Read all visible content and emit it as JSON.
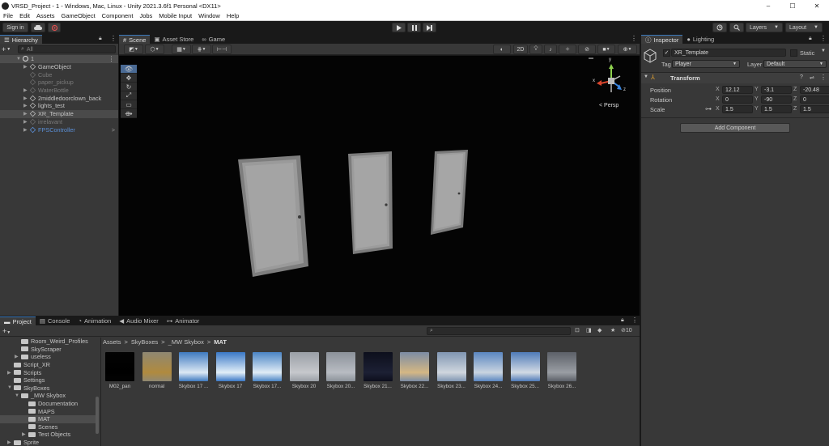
{
  "window": {
    "title": "VRSD_Project - 1 - Windows, Mac, Linux - Unity 2021.3.6f1 Personal <DX11>",
    "minimize": "–",
    "maximize": "☐",
    "close": "✕"
  },
  "menu": [
    "File",
    "Edit",
    "Assets",
    "GameObject",
    "Component",
    "Jobs",
    "Mobile Input",
    "Window",
    "Help"
  ],
  "toolbar": {
    "sign_in": "Sign in",
    "layers": "Layers",
    "layout": "Layout"
  },
  "hierarchy": {
    "tab": "Hierarchy",
    "search_placeholder": "All",
    "scene_name": "1",
    "items": [
      {
        "label": "GameObject",
        "state": "normal",
        "arrow": "▶"
      },
      {
        "label": "Cube",
        "state": "disabled",
        "arrow": ""
      },
      {
        "label": "paper_pickup",
        "state": "disabled",
        "arrow": ""
      },
      {
        "label": "WaterBottle",
        "state": "disabled",
        "arrow": "▶"
      },
      {
        "label": "2middledoorclown_back",
        "state": "normal",
        "arrow": "▶"
      },
      {
        "label": "lights_test",
        "state": "normal",
        "arrow": "▶"
      },
      {
        "label": "XR_Template",
        "state": "selected",
        "arrow": "▶"
      },
      {
        "label": "irrelavant",
        "state": "disabled",
        "arrow": "▶"
      },
      {
        "label": "FPSController",
        "state": "prefab",
        "arrow": "▶"
      }
    ]
  },
  "scene_view": {
    "tabs": [
      "Scene",
      "Asset Store",
      "Game"
    ],
    "mode_2d": "2D",
    "persp_label": "< Persp",
    "gizmo_y": "y",
    "gizmo_x": "x",
    "gizmo_z": "z"
  },
  "inspector": {
    "tabs": [
      "Inspector",
      "Lighting"
    ],
    "object_name": "XR_Template",
    "static_label": "Static",
    "tag_label": "Tag",
    "tag_value": "Player",
    "layer_label": "Layer",
    "layer_value": "Default",
    "component": "Transform",
    "position_label": "Position",
    "rotation_label": "Rotation",
    "scale_label": "Scale",
    "axes": [
      "X",
      "Y",
      "Z"
    ],
    "position": [
      "12.12",
      "-3.1",
      "-20.48"
    ],
    "rotation": [
      "0",
      "-90",
      "0"
    ],
    "scale": [
      "1.5",
      "1.5",
      "1.5"
    ],
    "add_component": "Add Component"
  },
  "bottom_tabs": [
    "Project",
    "Console",
    "Animation",
    "Audio Mixer",
    "Animator"
  ],
  "project": {
    "tree": [
      {
        "label": "Room_Weird_Profiles",
        "indent": 2,
        "arrow": ""
      },
      {
        "label": "SkyScraper",
        "indent": 2,
        "arrow": ""
      },
      {
        "label": "useless",
        "indent": 2,
        "arrow": "▶"
      },
      {
        "label": "Script_XR",
        "indent": 1,
        "arrow": ""
      },
      {
        "label": "Scripts",
        "indent": 1,
        "arrow": "▶"
      },
      {
        "label": "Settings",
        "indent": 1,
        "arrow": ""
      },
      {
        "label": "SkyBoxes",
        "indent": 1,
        "arrow": "▼"
      },
      {
        "label": "_MW Skybox",
        "indent": 2,
        "arrow": "▼"
      },
      {
        "label": "Documentation",
        "indent": 3,
        "arrow": ""
      },
      {
        "label": "MAPS",
        "indent": 3,
        "arrow": ""
      },
      {
        "label": "MAT",
        "indent": 3,
        "arrow": "",
        "selected": true
      },
      {
        "label": "Scenes",
        "indent": 3,
        "arrow": ""
      },
      {
        "label": "Test Objects",
        "indent": 3,
        "arrow": "▶"
      },
      {
        "label": "Sprite",
        "indent": 1,
        "arrow": "▶"
      }
    ],
    "breadcrumb": [
      "Assets",
      "SkyBoxes",
      "_MW Skybox",
      "MAT"
    ],
    "hidden_count": "10",
    "assets": [
      {
        "label": "M02_pan",
        "color1": "#030303",
        "color2": "#000000"
      },
      {
        "label": "normal",
        "color1": "#8f8872",
        "color2": "#b08a3e"
      },
      {
        "label": "Skybox 17 ...",
        "color1": "#3f7ac0",
        "color2": "#dce8f4"
      },
      {
        "label": "Skybox 17",
        "color1": "#3a78c6",
        "color2": "#e2eef8"
      },
      {
        "label": "Skybox 17...",
        "color1": "#4a84c4",
        "color2": "#e0ecf6"
      },
      {
        "label": "Skybox 20",
        "color1": "#9a9fa6",
        "color2": "#c6c8cc"
      },
      {
        "label": "Skybox 20...",
        "color1": "#8c929a",
        "color2": "#b8bcc2"
      },
      {
        "label": "Skybox 21...",
        "color1": "#0d0f1c",
        "color2": "#1c2034"
      },
      {
        "label": "Skybox 22...",
        "color1": "#7c8ca4",
        "color2": "#d4b784"
      },
      {
        "label": "Skybox 23...",
        "color1": "#8096b2",
        "color2": "#cfd6de"
      },
      {
        "label": "Skybox 24...",
        "color1": "#5a86c0",
        "color2": "#c9d4e0"
      },
      {
        "label": "Skybox 25...",
        "color1": "#4f7bb8",
        "color2": "#d2dae4"
      },
      {
        "label": "Skybox 26...",
        "color1": "#5c6068",
        "color2": "#9a9ea4"
      }
    ]
  },
  "colors": {
    "selection": "#2c5d87",
    "accent": "#3a79bb"
  }
}
